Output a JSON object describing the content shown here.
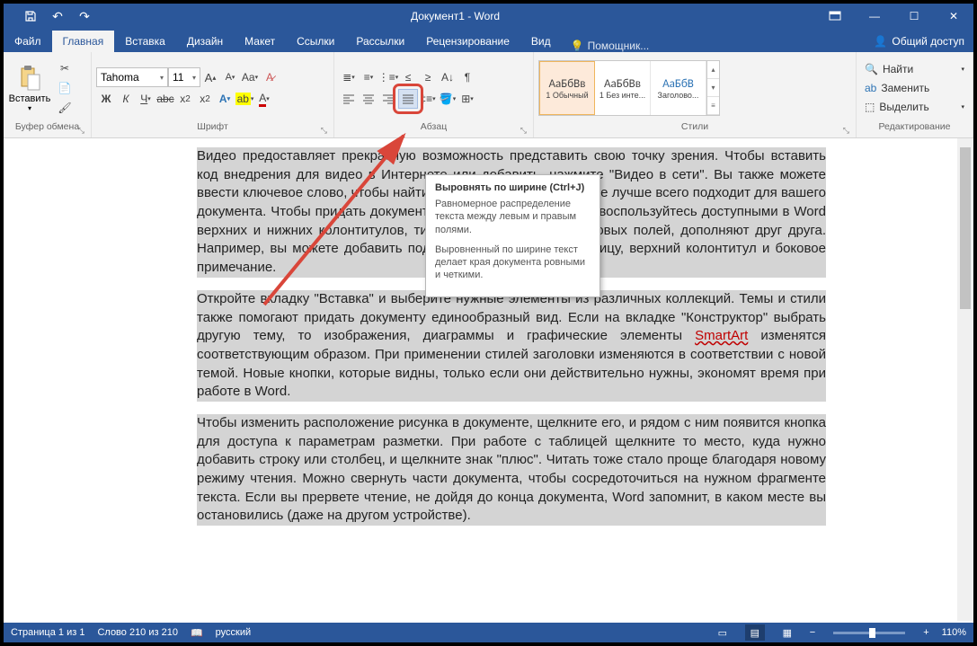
{
  "titlebar": {
    "title": "Документ1 - Word"
  },
  "tabs": {
    "items": [
      "Файл",
      "Главная",
      "Вставка",
      "Дизайн",
      "Макет",
      "Ссылки",
      "Рассылки",
      "Рецензирование",
      "Вид"
    ],
    "active": 1,
    "tellme": "Помощник...",
    "share": "Общий доступ"
  },
  "ribbon": {
    "clipboard": {
      "label": "Буфер обмена",
      "paste": "Вставить"
    },
    "font": {
      "label": "Шрифт",
      "name": "Tahoma",
      "size": "11"
    },
    "paragraph": {
      "label": "Абзац"
    },
    "styles": {
      "label": "Стили",
      "items": [
        {
          "preview": "АаБбВв",
          "name": "1 Обычный",
          "selected": true
        },
        {
          "preview": "АаБбВв",
          "name": "1 Без инте..."
        },
        {
          "preview": "АаБбВ",
          "name": "Заголово...",
          "color": "#2e74b5"
        }
      ]
    },
    "editing": {
      "label": "Редактирование",
      "find": "Найти",
      "replace": "Заменить",
      "select": "Выделить"
    }
  },
  "tooltip": {
    "title": "Выровнять по ширине (Ctrl+J)",
    "p1": "Равномерное распределение текста между левым и правым полями.",
    "p2": "Выровненный по ширине текст делает края документа ровными и четкими."
  },
  "document": {
    "p1": "Видео предоставляет прекрасную возможность представить свою точку зрения. Чтобы вставить код внедрения для видео в Интернете или добавить, нажмите \"Видео в сети\". Вы также можете ввести ключевое слово, чтобы найти в Интернете видео, которое лучше всего подходит для вашего документа. Чтобы придать документу профессиональный вид, воспользуйтесь доступными в Word верхних и нижних колонтитулов, титульной страницы и текстовых полей, дополняют друг друга. Например, вы можете добавить подходящую титульную страницу, верхний колонтитул и боковое примечание.",
    "p2a": "Откройте вкладку \"Вставка\" и выберите нужные элементы из различных коллекций. Темы и стили также помогают придать документу единообразный вид. Если на вкладке \"Конструктор\" выбрать другую тему, то изображения, диаграммы и графические элементы ",
    "p2b": " изменятся соответствующим образом. При применении стилей заголовки изменяются в соответствии с новой темой. Новые кнопки, которые видны, только если они действительно нужны, экономят время при работе в Word.",
    "smartart": "SmartArt",
    "p3": "Чтобы изменить расположение рисунка в документе, щелкните его, и рядом с ним появится кнопка для доступа к параметрам разметки. При работе с таблицей щелкните то место, куда нужно добавить строку или столбец, и щелкните знак \"плюс\". Читать тоже стало проще благодаря новому режиму чтения. Можно свернуть части документа, чтобы сосредоточиться на нужном фрагменте текста. Если вы прервете чтение, не дойдя до конца документа, Word запомнит, в каком месте вы остановились (даже на другом устройстве)."
  },
  "statusbar": {
    "page": "Страница 1 из 1",
    "words": "Слово 210 из 210",
    "lang": "русский",
    "zoom": "110%"
  }
}
